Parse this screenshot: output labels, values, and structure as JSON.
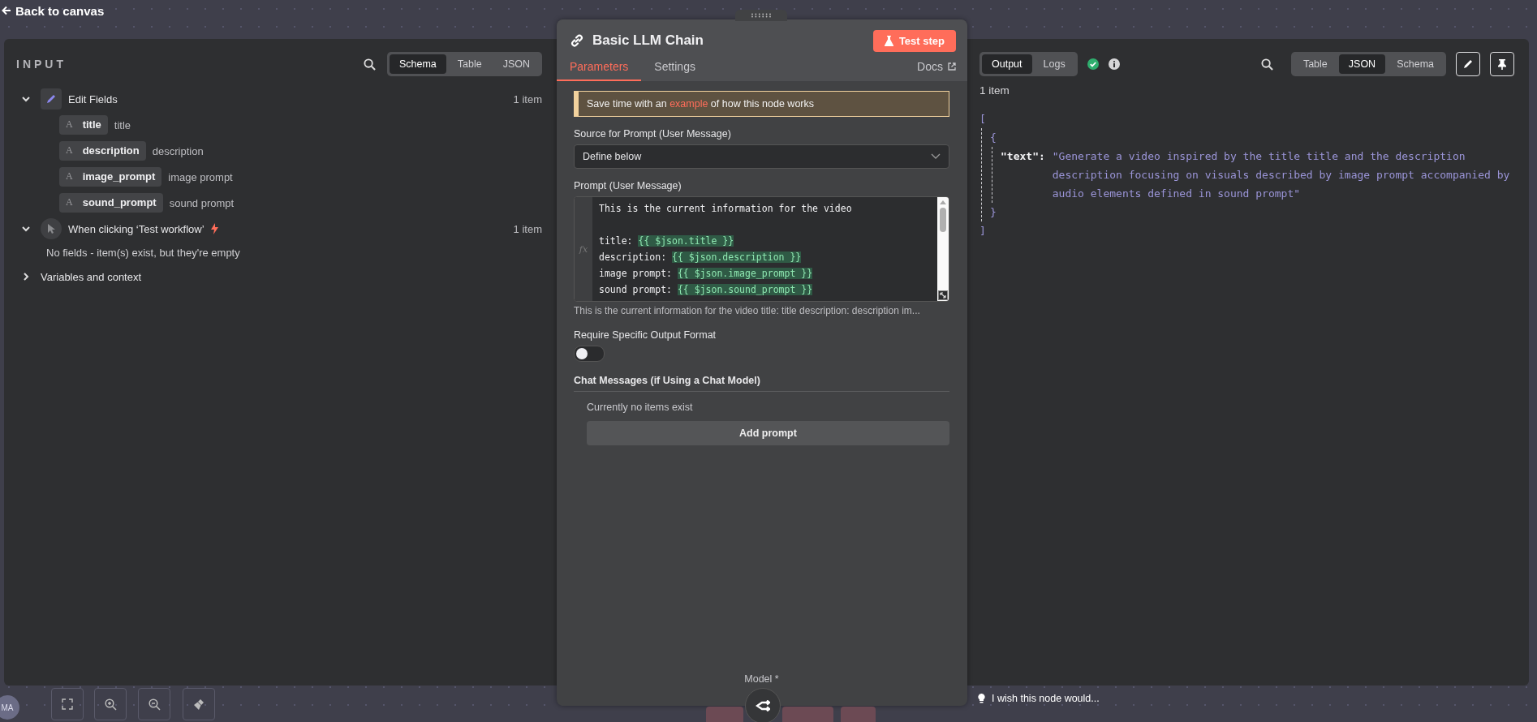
{
  "top_bar": {
    "back_link": "Back to canvas"
  },
  "input_panel": {
    "title": "INPUT",
    "view_tabs": [
      {
        "label": "Schema",
        "selected": true
      },
      {
        "label": "Table",
        "selected": false
      },
      {
        "label": "JSON",
        "selected": false
      }
    ],
    "nodes": [
      {
        "kind": "edit",
        "label": "Edit Fields",
        "count": "1 item",
        "expanded": true,
        "fields": [
          {
            "type": "A",
            "key": "title",
            "value": "title"
          },
          {
            "type": "A",
            "key": "description",
            "value": "description"
          },
          {
            "type": "A",
            "key": "image_prompt",
            "value": "image prompt"
          },
          {
            "type": "A",
            "key": "sound_prompt",
            "value": "sound prompt"
          }
        ]
      },
      {
        "kind": "trigger",
        "label": "When clicking ‘Test workflow’",
        "count": "1 item",
        "expanded": true,
        "empty_message": "No fields - item(s) exist, but they're empty"
      },
      {
        "kind": "section",
        "label": "Variables and context",
        "expanded": false
      }
    ]
  },
  "node_panel": {
    "title": "Basic LLM Chain",
    "test_button": "Test step",
    "tabs": [
      {
        "label": "Parameters",
        "selected": true
      },
      {
        "label": "Settings",
        "selected": false
      }
    ],
    "docs_link": "Docs",
    "notice": {
      "before": "Save time with an ",
      "link": "example",
      "after": " of how this node works"
    },
    "source": {
      "label": "Source for Prompt (User Message)",
      "value": "Define below"
    },
    "prompt": {
      "label": "Prompt (User Message)",
      "gutter": "fx",
      "lines": [
        {
          "gap_before": false,
          "segments": [
            {
              "kind": "text",
              "text": "This is the current information for the video"
            }
          ]
        },
        {
          "gap_before": true,
          "segments": [
            {
              "kind": "text",
              "text": "title: "
            },
            {
              "kind": "expression",
              "text": "{{ $json.title }}"
            }
          ]
        },
        {
          "gap_before": false,
          "segments": [
            {
              "kind": "text",
              "text": "description: "
            },
            {
              "kind": "expression",
              "text": "{{ $json.description }}"
            }
          ]
        },
        {
          "gap_before": false,
          "segments": [
            {
              "kind": "text",
              "text": "image prompt: "
            },
            {
              "kind": "expression",
              "text": "{{ $json.image_prompt }}"
            }
          ]
        },
        {
          "gap_before": false,
          "segments": [
            {
              "kind": "text",
              "text": "sound prompt: "
            },
            {
              "kind": "expression",
              "text": "{{ $json.sound_prompt }}"
            }
          ]
        }
      ],
      "preview": "This is the current information for the video title: title description: description im..."
    },
    "output_format": {
      "label": "Require Specific Output Format",
      "on": false
    },
    "chat_messages": {
      "label": "Chat Messages (if Using a Chat Model)",
      "empty_message": "Currently no items exist",
      "add_button": "Add prompt"
    },
    "model_label": "Model *"
  },
  "output_panel": {
    "tabs": [
      {
        "label": "Output",
        "selected": true
      },
      {
        "label": "Logs",
        "selected": false
      }
    ],
    "view_tabs": [
      {
        "label": "Table",
        "selected": false
      },
      {
        "label": "JSON",
        "selected": true
      },
      {
        "label": "Schema",
        "selected": false
      }
    ],
    "count": "1 item",
    "json": {
      "open_bracket": "[",
      "open_brace": "{",
      "key": "\"text\":",
      "value": "\"Generate a video inspired by the title title and the description description focusing on visuals described by image prompt accompanied by audio elements defined in sound prompt\"",
      "close_brace": "}",
      "close_bracket": "]"
    }
  },
  "canvas": {
    "avatar": "MA",
    "feedback": "I wish this node would..."
  }
}
